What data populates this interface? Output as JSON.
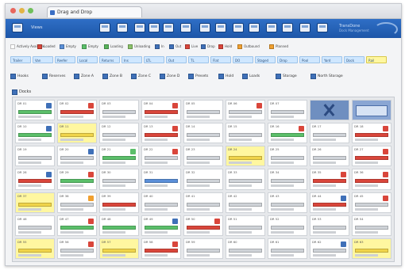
{
  "window": {
    "tab_title": "Drag and Drop"
  },
  "toolbar": {
    "label": "Views",
    "logo_line1": "TransDone",
    "logo_line2": "Dock Management",
    "colors": {
      "bar": "#1d56a8"
    }
  },
  "legend": [
    {
      "label": "Actively Available",
      "color": "#ffffff"
    },
    {
      "label": "Loaded",
      "color": "#d9463b"
    },
    {
      "label": "Empty",
      "color": "#5b8fd8"
    },
    {
      "label": "Empty",
      "color": "#5bbf6a"
    },
    {
      "label": "Loading",
      "color": "#58b35c"
    },
    {
      "label": "Unloading",
      "color": "#8ac26a"
    },
    {
      "label": "In",
      "color": "#3f70b8"
    },
    {
      "label": "Out",
      "color": "#3f70b8"
    },
    {
      "label": "Live",
      "color": "#d9463b"
    },
    {
      "label": "Drop",
      "color": "#3f70b8"
    },
    {
      "label": "Hold",
      "color": "#d9463b"
    },
    {
      "label": "Outbound",
      "color": "#f0a030"
    },
    {
      "label": "Planned",
      "color": "#f0a030"
    }
  ],
  "type_chips": [
    "Trailer",
    "Van",
    "Reefer",
    "Local",
    "Returns",
    "Ins",
    "LTL",
    "Out",
    "TL",
    "Flat",
    "DO",
    "Staged",
    "Drop",
    "Pool",
    "Yard",
    "Dock",
    "Rail"
  ],
  "filters": [
    "Hooks",
    "Reserves",
    "Zone A",
    "Zone B",
    "Zone C",
    "Zone D",
    "Presets",
    "Hold",
    "Loads",
    "Storage",
    "North Storage"
  ],
  "section": {
    "label": "Docks"
  },
  "grid": {
    "rows": 7,
    "cols": 9,
    "slots": [
      {
        "label": "DR 01",
        "kind": "g",
        "bar": "#5bbf6a",
        "icon": "#3f70b8"
      },
      {
        "label": "DR 02",
        "kind": "r",
        "bar": "#d9463b",
        "icon": "#d9463b"
      },
      {
        "label": "DR 03",
        "kind": "w",
        "bar": "#cfd3d8",
        "icon": ""
      },
      {
        "label": "DR 04",
        "kind": "r",
        "bar": "#d9463b",
        "icon": "#d9463b"
      },
      {
        "label": "DR 05",
        "kind": "w",
        "bar": "#cfd3d8",
        "icon": ""
      },
      {
        "label": "DR 06",
        "kind": "w",
        "bar": "#cfd3d8",
        "icon": "#d9463b"
      },
      {
        "label": "DR 07",
        "kind": "w",
        "bar": "#cfd3d8",
        "icon": ""
      },
      {
        "label": "",
        "kind": "xlogo",
        "bar": "",
        "icon": ""
      },
      {
        "label": "",
        "kind": "alogo",
        "bar": "",
        "icon": ""
      },
      {
        "label": "DR 10",
        "kind": "g",
        "bar": "#5bbf6a",
        "icon": "#3f70b8"
      },
      {
        "label": "DR 11",
        "kind": "y",
        "bar": "#f0d44a",
        "icon": ""
      },
      {
        "label": "DR 12",
        "kind": "w",
        "bar": "#cfd3d8",
        "icon": ""
      },
      {
        "label": "DR 13",
        "kind": "r",
        "bar": "#d9463b",
        "icon": "#d9463b"
      },
      {
        "label": "DR 14",
        "kind": "w",
        "bar": "#cfd3d8",
        "icon": ""
      },
      {
        "label": "DR 15",
        "kind": "w",
        "bar": "#cfd3d8",
        "icon": ""
      },
      {
        "label": "DR 16",
        "kind": "g",
        "bar": "#5bbf6a",
        "icon": "#d9463b"
      },
      {
        "label": "DR 17",
        "kind": "w",
        "bar": "#cfd3d8",
        "icon": ""
      },
      {
        "label": "DR 18",
        "kind": "r",
        "bar": "#d9463b",
        "icon": "#d9463b"
      },
      {
        "label": "DR 19",
        "kind": "w",
        "bar": "#cfd3d8",
        "icon": ""
      },
      {
        "label": "DR 20",
        "kind": "w",
        "bar": "#cfd3d8",
        "icon": "#3f70b8"
      },
      {
        "label": "DR 21",
        "kind": "g",
        "bar": "#5bbf6a",
        "icon": "#5bbf6a"
      },
      {
        "label": "DR 22",
        "kind": "w",
        "bar": "#cfd3d8",
        "icon": "#d9463b"
      },
      {
        "label": "DR 23",
        "kind": "w",
        "bar": "#cfd3d8",
        "icon": ""
      },
      {
        "label": "DR 24",
        "kind": "y",
        "bar": "#f0d44a",
        "icon": ""
      },
      {
        "label": "DR 25",
        "kind": "w",
        "bar": "#cfd3d8",
        "icon": ""
      },
      {
        "label": "DR 26",
        "kind": "w",
        "bar": "#cfd3d8",
        "icon": ""
      },
      {
        "label": "DR 27",
        "kind": "r",
        "bar": "#d9463b",
        "icon": "#d9463b"
      },
      {
        "label": "DR 28",
        "kind": "r",
        "bar": "#d9463b",
        "icon": "#3f70b8"
      },
      {
        "label": "DR 29",
        "kind": "g",
        "bar": "#5bbf6a",
        "icon": "#d9463b"
      },
      {
        "label": "DR 30",
        "kind": "w",
        "bar": "#cfd3d8",
        "icon": ""
      },
      {
        "label": "DR 31",
        "kind": "b",
        "bar": "#5b8fd8",
        "icon": ""
      },
      {
        "label": "DR 32",
        "kind": "w",
        "bar": "#cfd3d8",
        "icon": ""
      },
      {
        "label": "DR 33",
        "kind": "w",
        "bar": "#cfd3d8",
        "icon": ""
      },
      {
        "label": "DR 34",
        "kind": "w",
        "bar": "#cfd3d8",
        "icon": ""
      },
      {
        "label": "DR 35",
        "kind": "r",
        "bar": "#d9463b",
        "icon": "#d9463b"
      },
      {
        "label": "DR 36",
        "kind": "r",
        "bar": "#d9463b",
        "icon": "#d9463b"
      },
      {
        "label": "DR 37",
        "kind": "y",
        "bar": "#f0d44a",
        "icon": ""
      },
      {
        "label": "DR 38",
        "kind": "w",
        "bar": "#cfd3d8",
        "icon": "#f0a030"
      },
      {
        "label": "DR 39",
        "kind": "r",
        "bar": "#d9463b",
        "icon": ""
      },
      {
        "label": "DR 40",
        "kind": "w",
        "bar": "#cfd3d8",
        "icon": ""
      },
      {
        "label": "DR 41",
        "kind": "w",
        "bar": "#cfd3d8",
        "icon": ""
      },
      {
        "label": "DR 42",
        "kind": "w",
        "bar": "#cfd3d8",
        "icon": ""
      },
      {
        "label": "DR 43",
        "kind": "w",
        "bar": "#cfd3d8",
        "icon": ""
      },
      {
        "label": "DR 44",
        "kind": "r",
        "bar": "#d9463b",
        "icon": "#3f70b8"
      },
      {
        "label": "DR 45",
        "kind": "w",
        "bar": "#cfd3d8",
        "icon": "#d9463b"
      },
      {
        "label": "DR 46",
        "kind": "w",
        "bar": "#cfd3d8",
        "icon": ""
      },
      {
        "label": "DR 47",
        "kind": "g",
        "bar": "#5bbf6a",
        "icon": "#d9463b"
      },
      {
        "label": "DR 48",
        "kind": "g",
        "bar": "#5bbf6a",
        "icon": ""
      },
      {
        "label": "DR 49",
        "kind": "g",
        "bar": "#5bbf6a",
        "icon": "#3f70b8"
      },
      {
        "label": "DR 50",
        "kind": "r",
        "bar": "#d9463b",
        "icon": "#d9463b"
      },
      {
        "label": "DR 51",
        "kind": "w",
        "bar": "#cfd3d8",
        "icon": ""
      },
      {
        "label": "DR 52",
        "kind": "w",
        "bar": "#cfd3d8",
        "icon": ""
      },
      {
        "label": "DR 53",
        "kind": "w",
        "bar": "#cfd3d8",
        "icon": ""
      },
      {
        "label": "DR 54",
        "kind": "w",
        "bar": "#cfd3d8",
        "icon": ""
      },
      {
        "label": "DR 55",
        "kind": "y",
        "bar": "#f0d44a",
        "icon": ""
      },
      {
        "label": "DR 56",
        "kind": "w",
        "bar": "#cfd3d8",
        "icon": "#d9463b"
      },
      {
        "label": "DR 57",
        "kind": "y",
        "bar": "#f0d44a",
        "icon": ""
      },
      {
        "label": "DR 58",
        "kind": "r",
        "bar": "#d9463b",
        "icon": "#d9463b"
      },
      {
        "label": "DR 59",
        "kind": "w",
        "bar": "#cfd3d8",
        "icon": ""
      },
      {
        "label": "DR 60",
        "kind": "w",
        "bar": "#cfd3d8",
        "icon": ""
      },
      {
        "label": "DR 61",
        "kind": "w",
        "bar": "#cfd3d8",
        "icon": ""
      },
      {
        "label": "DR 62",
        "kind": "w",
        "bar": "#cfd3d8",
        "icon": "#3f70b8"
      },
      {
        "label": "DR 63",
        "kind": "y",
        "bar": "#f0d44a",
        "icon": ""
      }
    ]
  }
}
